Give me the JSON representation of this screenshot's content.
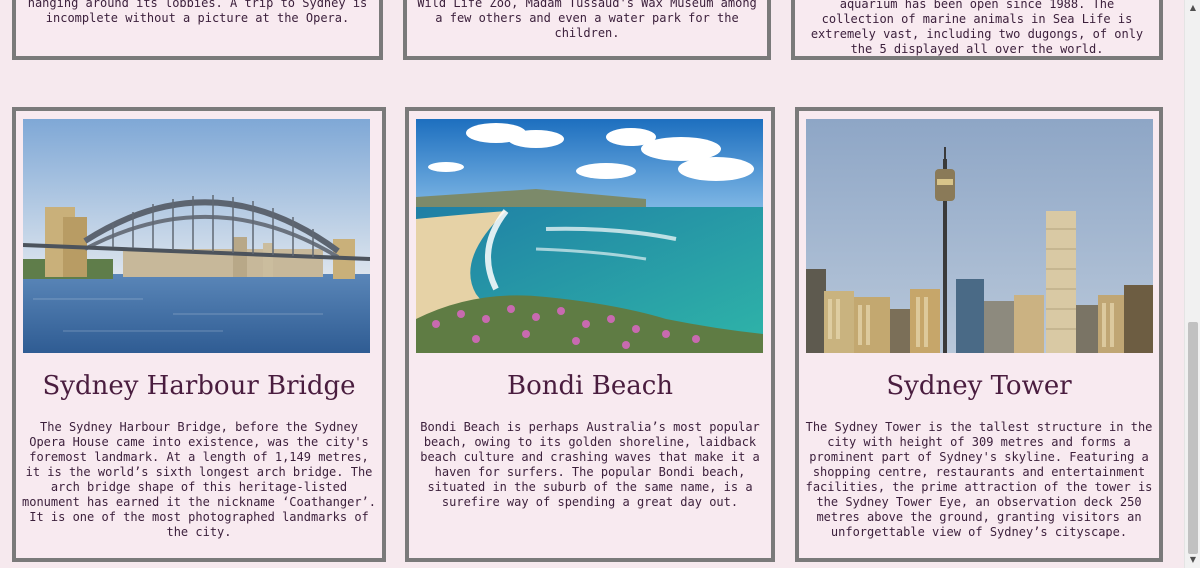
{
  "top_cards": [
    {
      "text": "hanging around its lobbies. A trip to Sydney is incomplete without a picture at the Opera."
    },
    {
      "text": "Wild Life Zoo, Madam Tussaud's Wax Museum among a few others and even a water park for the children."
    },
    {
      "text": "aquarium has been open since 1988. The collection of marine animals in Sea Life is extremely vast, including two dugongs, of only the 5 displayed all over the world."
    }
  ],
  "cards": [
    {
      "title": "Sydney Harbour Bridge",
      "image_alt": "Sydney Harbour Bridge photo",
      "text": "The Sydney Harbour Bridge, before the Sydney Opera House came into existence, was the city's foremost landmark. At a length of 1,149 metres, it is the world’s sixth longest arch bridge. The arch bridge shape of this heritage-listed monument has earned it the nickname ‘Coathanger’. It is one of the most photographed landmarks of the city."
    },
    {
      "title": "Bondi Beach",
      "image_alt": "Bondi Beach photo",
      "text": "Bondi Beach is perhaps Australia’s most popular beach, owing to its golden shoreline, laidback beach culture and crashing waves that make it a haven for surfers. The popular Bondi beach, situated in the suburb of the same name, is a surefire way of spending a great day out."
    },
    {
      "title": "Sydney Tower",
      "image_alt": "Sydney Tower photo",
      "text": "The Sydney Tower is the tallest structure in the city with height of 309 metres and forms a prominent part of Sydney's skyline. Featuring a shopping centre, restaurants and entertainment facilities, the prime attraction of the tower is the Sydney Tower Eye, an observation deck 250 metres above the ground, granting visitors an unforgettable view of Sydney’s cityscape."
    }
  ],
  "scrollbar": {
    "up_icon": "triangle-up-icon",
    "down_icon": "triangle-down-icon"
  },
  "colors": {
    "background": "#f6e9ee",
    "border": "#7a7a7a",
    "title": "#4a1d3f",
    "text": "#3b1f3b"
  }
}
